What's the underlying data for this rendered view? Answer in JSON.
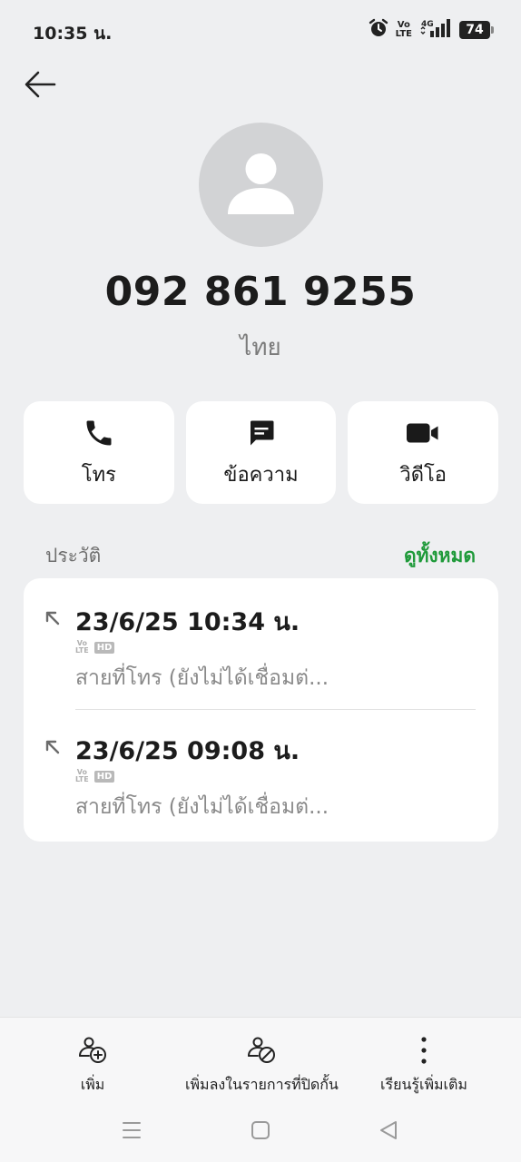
{
  "status_bar": {
    "time": "10:35 น.",
    "volte": "Vo\nLTE",
    "network": "4G",
    "battery": "74"
  },
  "contact": {
    "phone_number": "092 861 9255",
    "location": "ไทย"
  },
  "actions": [
    {
      "label": "โทร",
      "icon": "phone-icon"
    },
    {
      "label": "ข้อความ",
      "icon": "message-icon"
    },
    {
      "label": "วิดีโอ",
      "icon": "video-icon"
    }
  ],
  "history": {
    "title": "ประวัติ",
    "see_all": "ดูทั้งหมด",
    "entries": [
      {
        "time": "23/6/25 10:34 น.",
        "volte": "Vo\nLTE",
        "hd": "HD",
        "status": "สายที่โทร (ยังไม่ได้เชื่อมต่..."
      },
      {
        "time": "23/6/25 09:08 น.",
        "volte": "Vo\nLTE",
        "hd": "HD",
        "status": "สายที่โทร (ยังไม่ได้เชื่อมต่..."
      }
    ]
  },
  "bottom_actions": [
    {
      "label": "เพิ่ม",
      "icon": "add-contact-icon"
    },
    {
      "label": "เพิ่มลงในรายการที่ปิดกั้น",
      "icon": "block-contact-icon"
    },
    {
      "label": "เรียนรู้เพิ่มเติม",
      "icon": "more-vertical-icon"
    }
  ],
  "colors": {
    "background": "#eeeff1",
    "card": "#ffffff",
    "accent_green": "#1f9a3a",
    "avatar_bg": "#d2d3d5"
  }
}
